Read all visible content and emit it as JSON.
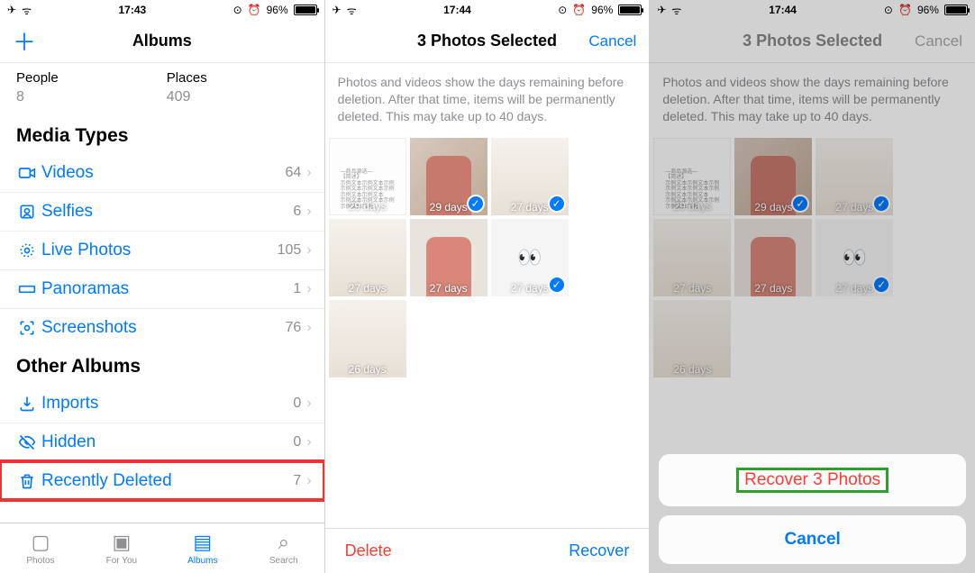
{
  "screen1": {
    "status": {
      "time": "17:43",
      "battery": "96%",
      "ap": "✈",
      "wifi": "✓"
    },
    "nav": {
      "title": "Albums",
      "plus_icon": "＋"
    },
    "people": {
      "label": "People",
      "count": "8"
    },
    "places": {
      "label": "Places",
      "count": "409"
    },
    "media_types_title": "Media Types",
    "media_types": [
      {
        "icon": "video-icon",
        "label": "Videos",
        "count": "64"
      },
      {
        "icon": "selfie-icon",
        "label": "Selfies",
        "count": "6"
      },
      {
        "icon": "live-photo-icon",
        "label": "Live Photos",
        "count": "105"
      },
      {
        "icon": "panorama-icon",
        "label": "Panoramas",
        "count": "1"
      },
      {
        "icon": "screenshot-icon",
        "label": "Screenshots",
        "count": "76"
      }
    ],
    "other_albums_title": "Other Albums",
    "other_albums": [
      {
        "icon": "import-icon",
        "label": "Imports",
        "count": "0"
      },
      {
        "icon": "hidden-icon",
        "label": "Hidden",
        "count": "0"
      },
      {
        "icon": "trash-icon",
        "label": "Recently Deleted",
        "count": "7",
        "highlight": true
      }
    ],
    "tabbar": {
      "photos": "Photos",
      "foryou": "For You",
      "albums": "Albums",
      "search": "Search"
    }
  },
  "screen2": {
    "status": {
      "time": "17:44",
      "battery": "96%"
    },
    "nav": {
      "title": "3 Photos Selected",
      "cancel": "Cancel"
    },
    "info": "Photos and videos show the days remaining before deletion. After that time, items will be permanently deleted. This may take up to 40 days.",
    "thumbs": [
      {
        "kind": "text",
        "days": "29 days",
        "selected": false
      },
      {
        "kind": "torso",
        "days": "29 days",
        "selected": true
      },
      {
        "kind": "light",
        "days": "27 days",
        "selected": true
      },
      {
        "kind": "light",
        "days": "27 days",
        "selected": false
      },
      {
        "kind": "pink",
        "days": "27 days",
        "selected": false
      },
      {
        "kind": "eye",
        "days": "27 days",
        "selected": true
      },
      {
        "kind": "light",
        "days": "26 days",
        "selected": false
      }
    ],
    "bottom": {
      "delete": "Delete",
      "recover": "Recover"
    }
  },
  "screen3": {
    "status": {
      "time": "17:44",
      "battery": "96%"
    },
    "nav": {
      "title": "3 Photos Selected",
      "cancel": "Cancel"
    },
    "info": "Photos and videos show the days remaining before deletion. After that time, items will be permanently deleted. This may take up to 40 days.",
    "thumbs": [
      {
        "kind": "text",
        "days": "29 days",
        "selected": false
      },
      {
        "kind": "torso",
        "days": "29 days",
        "selected": true
      },
      {
        "kind": "light",
        "days": "27 days",
        "selected": true
      },
      {
        "kind": "light",
        "days": "27 days",
        "selected": false
      },
      {
        "kind": "pink",
        "days": "27 days",
        "selected": false
      },
      {
        "kind": "eye",
        "days": "27 days",
        "selected": true
      },
      {
        "kind": "light",
        "days": "26 days",
        "selected": false
      }
    ],
    "actionsheet": {
      "recover": "Recover 3 Photos",
      "cancel": "Cancel"
    }
  },
  "glyphs": {
    "airplane": "✈",
    "wifi": "ᯤ",
    "alarm": "⏰",
    "lock": "⊙",
    "chevron": "›",
    "check": "✓",
    "eyes": "👀"
  }
}
